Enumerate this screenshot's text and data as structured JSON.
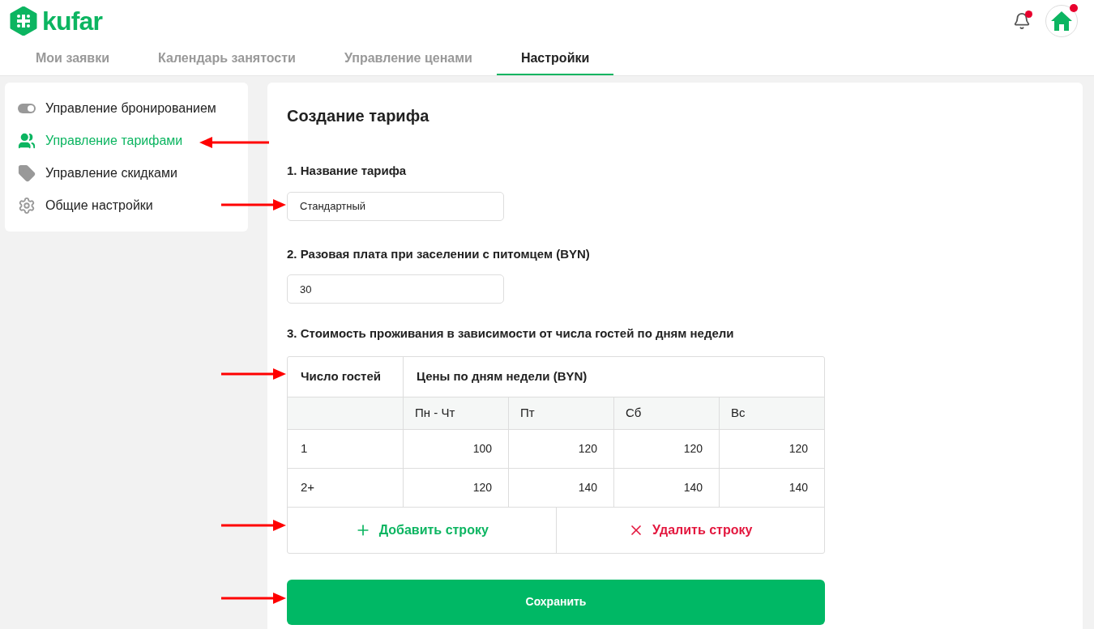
{
  "header": {
    "logo": "kufar",
    "notification_dot": true,
    "avatar_dot": true
  },
  "tabs": [
    {
      "label": "Мои заявки",
      "selected": false
    },
    {
      "label": "Календарь занятости",
      "selected": false
    },
    {
      "label": "Управление ценами",
      "selected": false
    },
    {
      "label": "Настройки",
      "selected": true
    }
  ],
  "sidebar": {
    "items": [
      {
        "kind": "toggle",
        "label": "Управление бронированием",
        "selected": false
      },
      {
        "kind": "people",
        "label": "Управление тарифами",
        "selected": true
      },
      {
        "kind": "tag",
        "label": "Управление скидками",
        "selected": false
      },
      {
        "kind": "gear",
        "label": "Общие настройки",
        "selected": false
      }
    ]
  },
  "form": {
    "title": "Создание тарифа",
    "name_label": "1. Название тарифа",
    "name_value": "Стандартный",
    "fee_label": "2. Разовая плата при заселении с питомцем (BYN)",
    "fee_value": "30",
    "table_label": "3. Стоимость проживания в зависимости от числа гостей по дням недели",
    "table": {
      "guests_header": "Число гостей",
      "prices_header": "Цены по дням недели (BYN)",
      "day_columns": [
        "Пн - Чт",
        "Пт",
        "Сб",
        "Вс"
      ],
      "rows": [
        {
          "guests": "1",
          "prices": [
            "100",
            "120",
            "120",
            "120"
          ]
        },
        {
          "guests": "2+",
          "prices": [
            "120",
            "140",
            "140",
            "140"
          ]
        }
      ]
    },
    "add_row": "Добавить строку",
    "delete_row": "Удалить строку",
    "save": "Сохранить"
  },
  "annotation_arrows": [
    {
      "kind": "left"
    },
    {
      "kind": "right"
    },
    {
      "kind": "right"
    },
    {
      "kind": "right"
    },
    {
      "kind": "right"
    }
  ]
}
